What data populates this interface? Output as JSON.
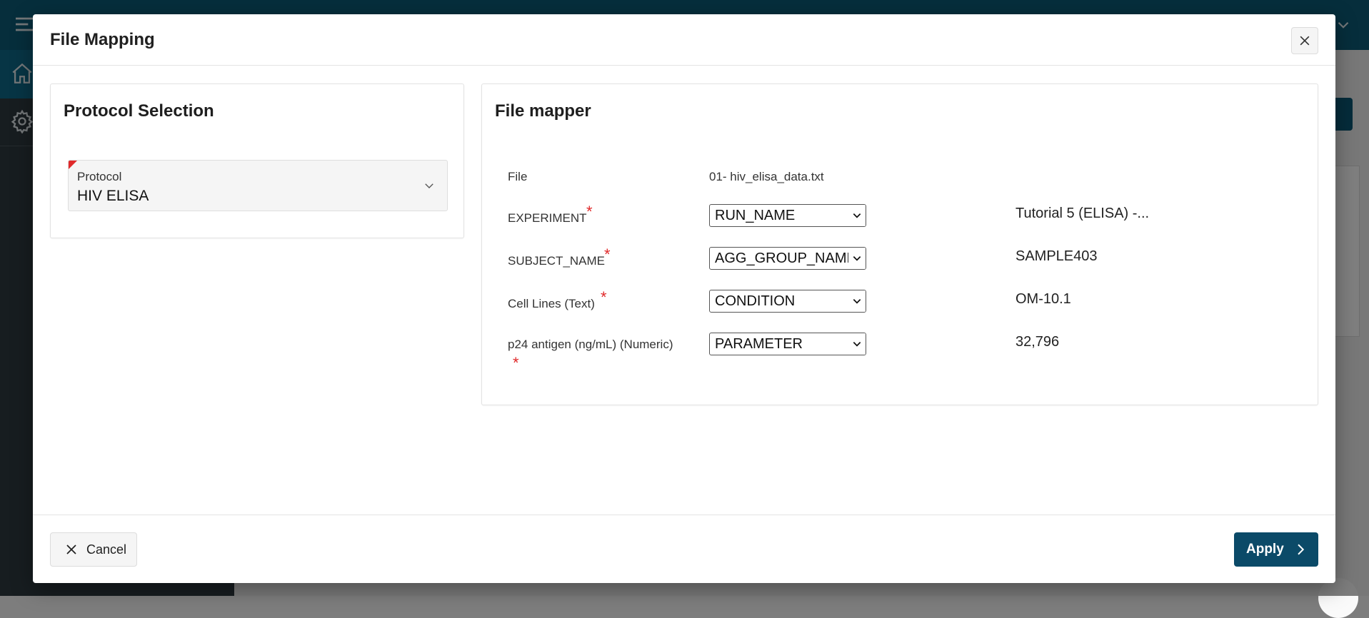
{
  "dialog": {
    "title": "File Mapping",
    "close_icon": "close-icon"
  },
  "protocol_selection": {
    "title": "Protocol Selection",
    "protocol_label": "Protocol",
    "protocol_value": "HIV ELISA"
  },
  "file_mapper": {
    "title": "File mapper",
    "file_label": "File",
    "file_name": "01- hiv_elisa_data.txt",
    "rows": [
      {
        "label": "EXPERIMENT",
        "required": true,
        "selected": "RUN_NAME",
        "sample": "Tutorial 5 (ELISA) -..."
      },
      {
        "label": "SUBJECT_NAME",
        "required": true,
        "selected": "AGG_GROUP_NAME",
        "sample": "SAMPLE403"
      },
      {
        "label": "Cell Lines (Text)",
        "required": true,
        "selected": "CONDITION",
        "sample": "OM-10.1"
      },
      {
        "label": "p24 antigen (ng/mL) (Numeric)",
        "required": true,
        "selected": "PARAMETER",
        "sample": "32,796"
      }
    ],
    "required_marker": "*"
  },
  "footer": {
    "cancel_label": "Cancel",
    "apply_label": "Apply"
  },
  "colors": {
    "primary": "#0b4a68",
    "required": "#e0292a"
  }
}
